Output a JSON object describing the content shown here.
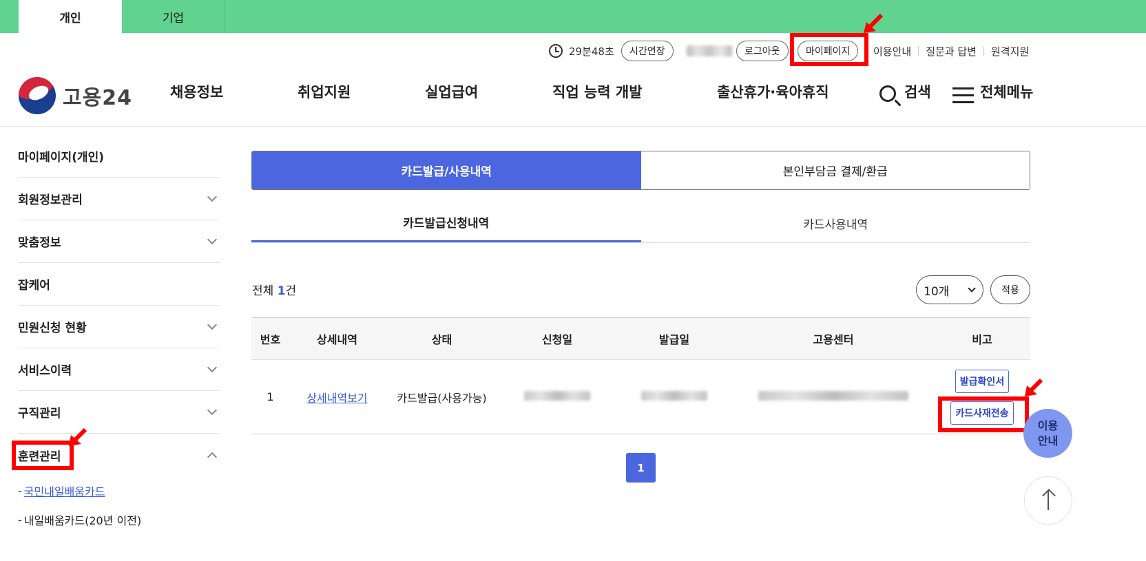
{
  "top_tabs": [
    "개인",
    "기업"
  ],
  "utility": {
    "timer": "29분48초",
    "extend_label": "시간연장",
    "logout_label": "로그아웃",
    "mypage_label": "마이페이지",
    "links": [
      "이용안내",
      "질문과 답변",
      "원격지원"
    ]
  },
  "logo": {
    "text": "고용24"
  },
  "nav": {
    "items": [
      "채용정보",
      "취업지원",
      "실업급여",
      "직업 능력 개발",
      "출산휴가·육아휴직"
    ],
    "search_label": "검색",
    "menu_label": "전체메뉴"
  },
  "sidebar": {
    "title": "마이페이지(개인)",
    "items": [
      "회원정보관리",
      "맞춤정보",
      "잡케어",
      "민원신청 현황",
      "서비스이력",
      "구직관리",
      "훈련관리"
    ],
    "sub_items": [
      "국민내일배움카드",
      "내일배움카드(20년 이전)"
    ]
  },
  "main": {
    "segments": [
      "카드발급/사용내역",
      "본인부담금 결제/환급"
    ],
    "subtabs": [
      "카드발급신청내역",
      "카드사용내역"
    ],
    "total_prefix": "전체 ",
    "total_count": "1",
    "total_suffix": "건",
    "page_size": "10개",
    "apply_label": "적용",
    "table": {
      "headers": [
        "번호",
        "상세내역",
        "상태",
        "신청일",
        "발급일",
        "고용센터",
        "비고"
      ],
      "rows": [
        {
          "no": "1",
          "detail_link": "상세내역보기",
          "status": "카드발급(사용가능)",
          "actions": [
            "발급확인서",
            "카드사재전송"
          ]
        }
      ]
    },
    "page": "1"
  },
  "fab": {
    "help_line1": "이용",
    "help_line2": "안내"
  },
  "colors": {
    "green": "#5fd38f",
    "accent": "#4c66e0",
    "annotation": "#ff0000"
  }
}
